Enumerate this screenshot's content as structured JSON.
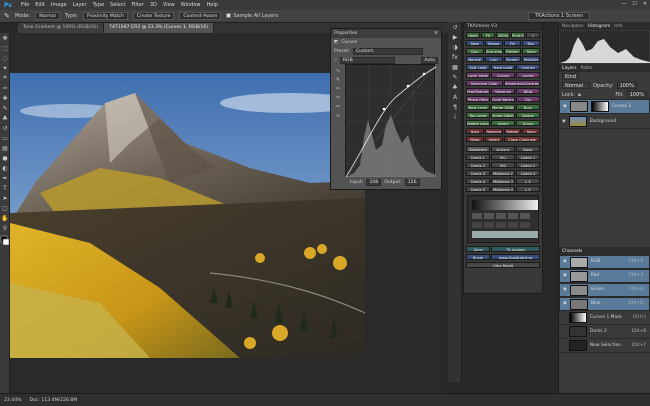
{
  "app": {
    "logo": "Ps",
    "menu": [
      "File",
      "Edit",
      "Image",
      "Layer",
      "Type",
      "Select",
      "Filter",
      "3D",
      "View",
      "Window",
      "Help"
    ]
  },
  "options": {
    "tool_label": "Tone Gradient",
    "mode_label": "Mode:",
    "mode_value": "Normal",
    "type_label": "Type:",
    "btn_proximity": "Proximity Match",
    "btn_texture": "Create Texture",
    "btn_content": "Content-Aware",
    "sample_label": "Sample All Layers",
    "workspace": "TKActions 1 Screen"
  },
  "doc": {
    "tab1": "Tone Gradient @ 100% (RGB/16)",
    "tab2": "7471047.CR2 @ 23.3% (Curves 1, RGB/16)"
  },
  "tools": [
    "brush-icon",
    "move-icon",
    "marquee-icon",
    "lasso-icon",
    "crop-icon",
    "eyedropper-icon",
    "heal-icon",
    "brush-icon",
    "stamp-icon",
    "history-icon",
    "eraser-icon",
    "gradient-icon",
    "blur-icon",
    "dodge-icon",
    "pen-icon",
    "type-icon",
    "path-icon",
    "shape-icon",
    "hand-icon",
    "zoom-icon"
  ],
  "properties": {
    "title": "Properties",
    "panel": "Curves",
    "preset_label": "Preset:",
    "preset_value": "Custom",
    "channel": "RGB",
    "auto": "Auto",
    "input_label": "Input:",
    "input_value": "108",
    "output_label": "Output:",
    "output_value": "156"
  },
  "tkactions": {
    "title": "TKActions V3",
    "row1": [
      "Open",
      "FX",
      "100%",
      "Print Size",
      "?"
    ],
    "row2": [
      "New",
      "Stamp",
      "Fill",
      "Blur"
    ],
    "row3": [
      "Dup",
      "Dup Image",
      "Flatten",
      "Save"
    ],
    "row4": [
      "Normal",
      "Lum",
      "Screen",
      "Multiply"
    ],
    "row5": [
      "Soft Light",
      "Hard Light",
      "Overlay"
    ],
    "row6": [
      "Layer Mask",
      "Curves",
      "Levels"
    ],
    "row7": [
      "Selective Color",
      "Brightness/Contrast"
    ],
    "row8": [
      "Hue/Saturation",
      "Vibrance",
      "B&W"
    ],
    "row9": [
      "Photo Filter",
      "Color Balance",
      "Clip"
    ],
    "row10": [
      "New Layer",
      "Merge Visible",
      "Burn"
    ],
    "row11": [
      "Top Layer",
      "Smart Object",
      "Dodge"
    ],
    "row12": [
      "Delete Layer",
      "Invert",
      "Group"
    ],
    "row13": [
      "Auto",
      "Remove",
      "Rotate",
      "Save"
    ],
    "row14": [
      "Mask",
      "Select",
      "Close Channels"
    ],
    "tabs": [
      "Spectrum",
      "Actions",
      "Basic"
    ],
    "lum1": [
      "Darks 1",
      "M/1",
      "Lights 1"
    ],
    "lum2": [
      "Darks 2",
      "M/2",
      "Lights 2"
    ],
    "lum3": [
      "Darks 3",
      "Midtones 2",
      "Lights 3"
    ],
    "lum4": [
      "Darks 4",
      "Midtones 3",
      "L 4"
    ],
    "lum5": [
      "Darks 5",
      "Midtones 4",
      "L 5"
    ],
    "footer1": "Zone",
    "footer2": "TK Actions",
    "footer3": "Brush",
    "footer4": "www.GoodLight.us",
    "footer5": "Ultra Rapid"
  },
  "navigator": {
    "tab1": "Navigator",
    "tab2": "Histogram",
    "tab3": "Info"
  },
  "layers": {
    "tab1": "Layers",
    "tab2": "Paths",
    "kind": "Kind",
    "blend": "Normal",
    "opacity_label": "Opacity:",
    "opacity": "100%",
    "lock": "Lock:",
    "fill_label": "Fill:",
    "fill": "100%",
    "items": [
      {
        "name": "Curves 1"
      },
      {
        "name": "Background"
      }
    ]
  },
  "channels": {
    "title": "Channels",
    "items": [
      {
        "name": "RGB",
        "shortcut": "Ctrl+2"
      },
      {
        "name": "Red",
        "shortcut": "Ctrl+3"
      },
      {
        "name": "Green",
        "shortcut": "Ctrl+4"
      },
      {
        "name": "Blue",
        "shortcut": "Ctrl+5"
      },
      {
        "name": "Curves 1 Mask",
        "shortcut": "Ctrl+\\"
      },
      {
        "name": "Darks 2",
        "shortcut": "Ctrl+6"
      },
      {
        "name": "New Selection",
        "shortcut": "Ctrl+7"
      }
    ]
  },
  "status": {
    "zoom": "23.44%",
    "doc": "Doc: 113.4M/226.8M"
  }
}
